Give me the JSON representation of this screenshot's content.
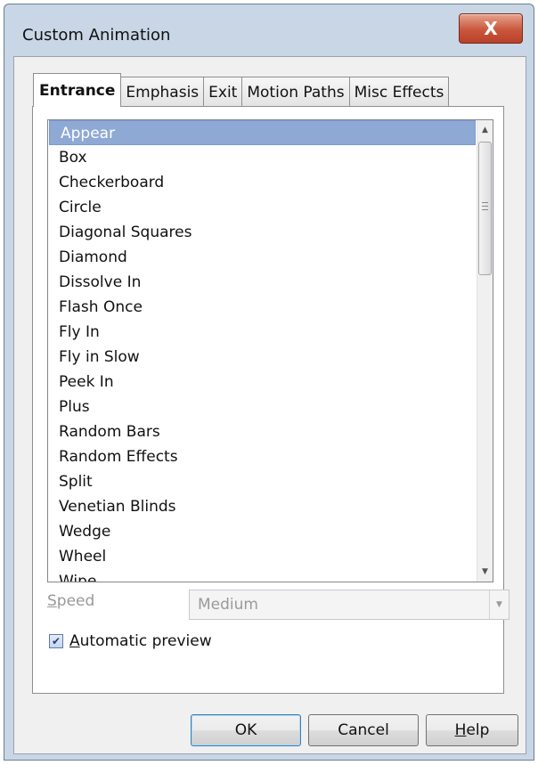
{
  "window": {
    "title": "Custom Animation",
    "close_label": "X"
  },
  "tabs": [
    {
      "label": "Entrance",
      "active": true
    },
    {
      "label": "Emphasis",
      "active": false
    },
    {
      "label": "Exit",
      "active": false
    },
    {
      "label": "Motion Paths",
      "active": false
    },
    {
      "label": "Misc Effects",
      "active": false
    }
  ],
  "effects_list": {
    "items": [
      "Appear",
      "Box",
      "Checkerboard",
      "Circle",
      "Diagonal Squares",
      "Diamond",
      "Dissolve In",
      "Flash Once",
      "Fly In",
      "Fly in Slow",
      "Peek In",
      "Plus",
      "Random Bars",
      "Random Effects",
      "Split",
      "Venetian Blinds",
      "Wedge",
      "Wheel",
      "Wipe"
    ],
    "selected": "Appear"
  },
  "speed": {
    "label_first": "S",
    "label_rest": "peed",
    "value": "Medium"
  },
  "auto_preview": {
    "checked": true,
    "label_first": "A",
    "label_rest": "utomatic preview"
  },
  "buttons": {
    "ok": "OK",
    "cancel": "Cancel",
    "help_first": "H",
    "help_rest": "elp"
  }
}
